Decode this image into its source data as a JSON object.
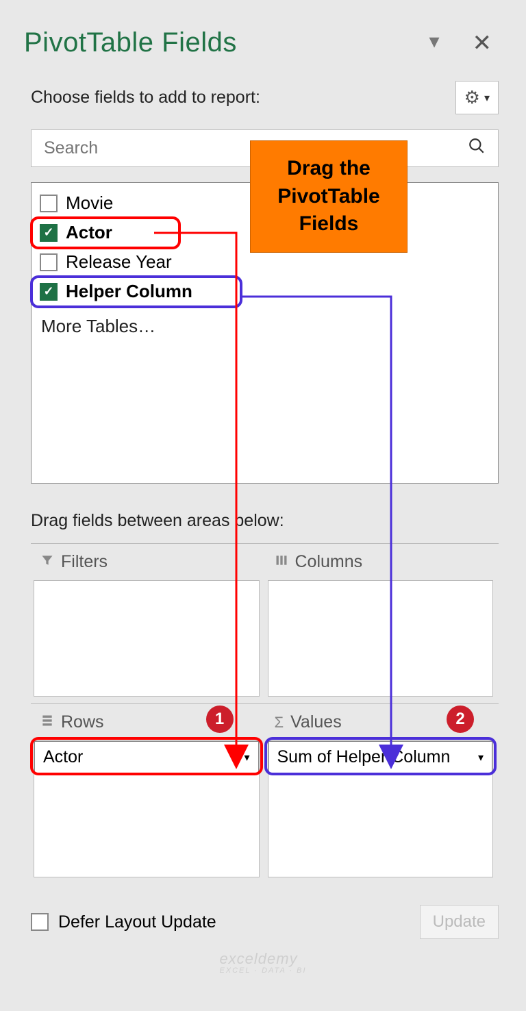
{
  "title": "PivotTable Fields",
  "subtitle": "Choose fields to add to report:",
  "search": {
    "placeholder": "Search"
  },
  "fields": [
    {
      "label": "Movie",
      "checked": false,
      "bold": false
    },
    {
      "label": "Actor",
      "checked": true,
      "bold": true
    },
    {
      "label": "Release Year",
      "checked": false,
      "bold": false
    },
    {
      "label": "Helper Column",
      "checked": true,
      "bold": true
    }
  ],
  "more_tables": "More Tables…",
  "areas_label": "Drag fields between areas below:",
  "areas": {
    "filters": {
      "label": "Filters"
    },
    "columns": {
      "label": "Columns"
    },
    "rows": {
      "label": "Rows",
      "chip": "Actor"
    },
    "values": {
      "label": "Values",
      "chip": "Sum of Helper Column"
    }
  },
  "defer_label": "Defer Layout Update",
  "update_label": "Update",
  "callout_text": "Drag the PivotTable Fields",
  "badges": {
    "one": "1",
    "two": "2"
  },
  "watermark": {
    "main": "exceldemy",
    "sub": "EXCEL · DATA · BI"
  }
}
